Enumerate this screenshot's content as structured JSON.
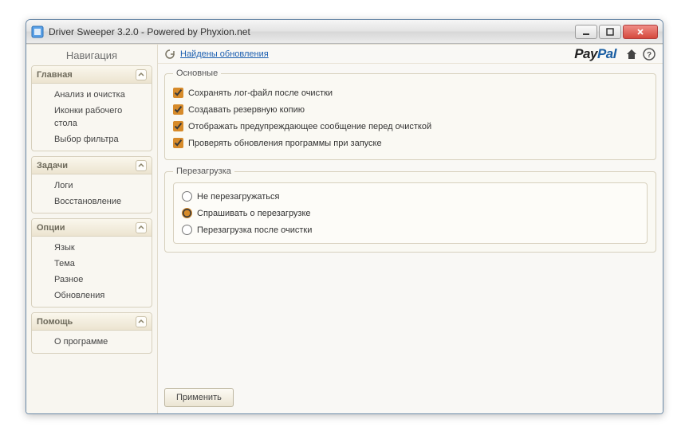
{
  "window": {
    "title": "Driver Sweeper 3.2.0 - Powered by Phyxion.net"
  },
  "sidebar": {
    "title": "Навигация",
    "groups": [
      {
        "label": "Главная",
        "items": [
          "Анализ и очистка",
          "Иконки рабочего стола",
          "Выбор фильтра"
        ]
      },
      {
        "label": "Задачи",
        "items": [
          "Логи",
          "Восстановление"
        ]
      },
      {
        "label": "Опции",
        "items": [
          "Язык",
          "Тема",
          "Разное",
          "Обновления"
        ]
      },
      {
        "label": "Помощь",
        "items": [
          "О программе"
        ]
      }
    ]
  },
  "topbar": {
    "update_link": "Найдены обновления",
    "paypal_pay": "Pay",
    "paypal_pal": "Pal"
  },
  "settings": {
    "main_group_title": "Основные",
    "checks": [
      {
        "label": "Сохранять лог-файл после очистки",
        "checked": true
      },
      {
        "label": "Создавать резервную копию",
        "checked": true
      },
      {
        "label": "Отображать предупреждающее сообщение перед очисткой",
        "checked": true
      },
      {
        "label": "Проверять обновления программы при запуске",
        "checked": true
      }
    ],
    "reboot_group_title": "Перезагрузка",
    "radios": [
      {
        "label": "Не перезагружаться",
        "checked": false
      },
      {
        "label": "Спрашивать о перезагрузке",
        "checked": true
      },
      {
        "label": "Перезагрузка после очистки",
        "checked": false
      }
    ]
  },
  "footer": {
    "apply_label": "Применить"
  }
}
